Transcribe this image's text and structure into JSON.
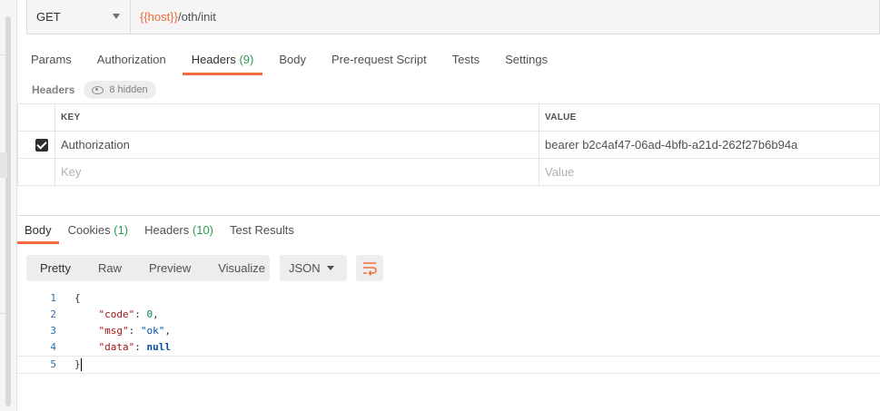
{
  "request": {
    "method": "GET",
    "url_variable": "{{host}}",
    "url_path": "/oth/init"
  },
  "request_tabs": [
    {
      "label": "Params",
      "count": ""
    },
    {
      "label": "Authorization",
      "count": ""
    },
    {
      "label": "Headers",
      "count": "(9)"
    },
    {
      "label": "Body",
      "count": ""
    },
    {
      "label": "Pre-request Script",
      "count": ""
    },
    {
      "label": "Tests",
      "count": ""
    },
    {
      "label": "Settings",
      "count": ""
    }
  ],
  "headers_section": {
    "label": "Headers",
    "hidden_text": "8 hidden",
    "columns": {
      "key": "KEY",
      "value": "VALUE"
    },
    "rows": [
      {
        "checked": true,
        "key": "Authorization",
        "value": "bearer b2c4af47-06ad-4bfb-a21d-262f27b6b94a"
      }
    ],
    "placeholder": {
      "key": "Key",
      "value": "Value"
    }
  },
  "response_tabs": [
    {
      "label": "Body",
      "count": ""
    },
    {
      "label": "Cookies",
      "count": "(1)"
    },
    {
      "label": "Headers",
      "count": "(10)"
    },
    {
      "label": "Test Results",
      "count": ""
    }
  ],
  "format_options": [
    "Pretty",
    "Raw",
    "Preview",
    "Visualize"
  ],
  "language": "JSON",
  "response_lines": [
    {
      "n": "1",
      "text": "{"
    },
    {
      "n": "2",
      "key": "\"code\"",
      "val": "0",
      "tail": ","
    },
    {
      "n": "3",
      "key": "\"msg\"",
      "val": "\"ok\"",
      "tail": ","
    },
    {
      "n": "4",
      "key": "\"data\"",
      "val": "null",
      "tail": ""
    },
    {
      "n": "5",
      "text": "}"
    }
  ],
  "colors": {
    "accent": "#f26b3a",
    "count_green": "#2c9c4f"
  }
}
